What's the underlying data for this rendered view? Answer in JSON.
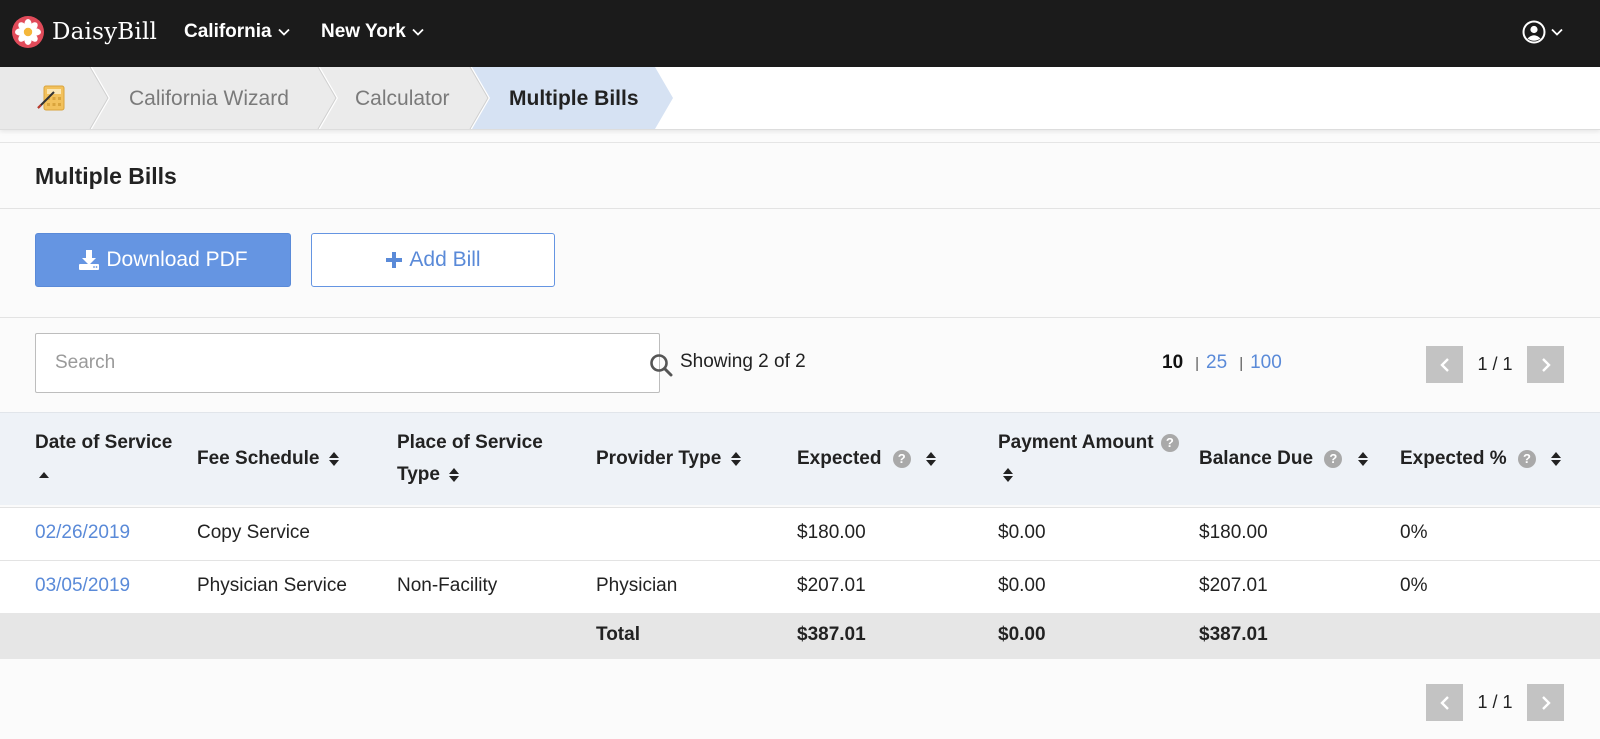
{
  "brand": {
    "name": "DaisyBill"
  },
  "nav": {
    "items": [
      {
        "label": "California"
      },
      {
        "label": "New York"
      }
    ]
  },
  "breadcrumb": {
    "home_icon": "calculator-pencil-icon",
    "items": [
      {
        "label": "California Wizard"
      },
      {
        "label": "Calculator"
      },
      {
        "label": "Multiple Bills",
        "active": true
      }
    ]
  },
  "page": {
    "title": "Multiple Bills",
    "buttons": {
      "download_pdf": "Download PDF",
      "add_bill": "Add Bill"
    },
    "search": {
      "placeholder": "Search",
      "value": ""
    },
    "showing": "Showing 2 of 2",
    "page_sizes": [
      "10",
      "25",
      "100"
    ],
    "page_size_selected": "10",
    "pagination": {
      "label": "1 / 1"
    }
  },
  "table": {
    "columns": [
      {
        "label": "Date of Service",
        "sort": "asc",
        "help": false
      },
      {
        "label": "Fee Schedule",
        "sort": "both",
        "help": false
      },
      {
        "label": "Place of Service Type",
        "sort": "both",
        "help": false
      },
      {
        "label": "Provider Type",
        "sort": "both",
        "help": false
      },
      {
        "label": "Expected",
        "sort": "both",
        "help": true
      },
      {
        "label": "Payment Amount",
        "sort": "both",
        "help": true
      },
      {
        "label": "Balance Due",
        "sort": "both",
        "help": true
      },
      {
        "label": "Expected %",
        "sort": "both",
        "help": true
      }
    ],
    "rows": [
      {
        "date": "02/26/2019",
        "fee_schedule": "Copy Service",
        "place_of_service": "",
        "provider_type": "",
        "expected": "$180.00",
        "payment": "$0.00",
        "balance": "$180.00",
        "expected_pct": "0%"
      },
      {
        "date": "03/05/2019",
        "fee_schedule": "Physician Service",
        "place_of_service": "Non-Facility",
        "provider_type": "Physician",
        "expected": "$207.01",
        "payment": "$0.00",
        "balance": "$207.01",
        "expected_pct": "0%"
      }
    ],
    "total": {
      "label": "Total",
      "expected": "$387.01",
      "payment": "$0.00",
      "balance": "$387.01"
    }
  },
  "colors": {
    "nav_bg": "#1b1b1b",
    "accent": "#6595e2",
    "link": "#5a8ad8",
    "active_crumb": "#d6e2f3",
    "header_bg": "#eef2f7"
  }
}
